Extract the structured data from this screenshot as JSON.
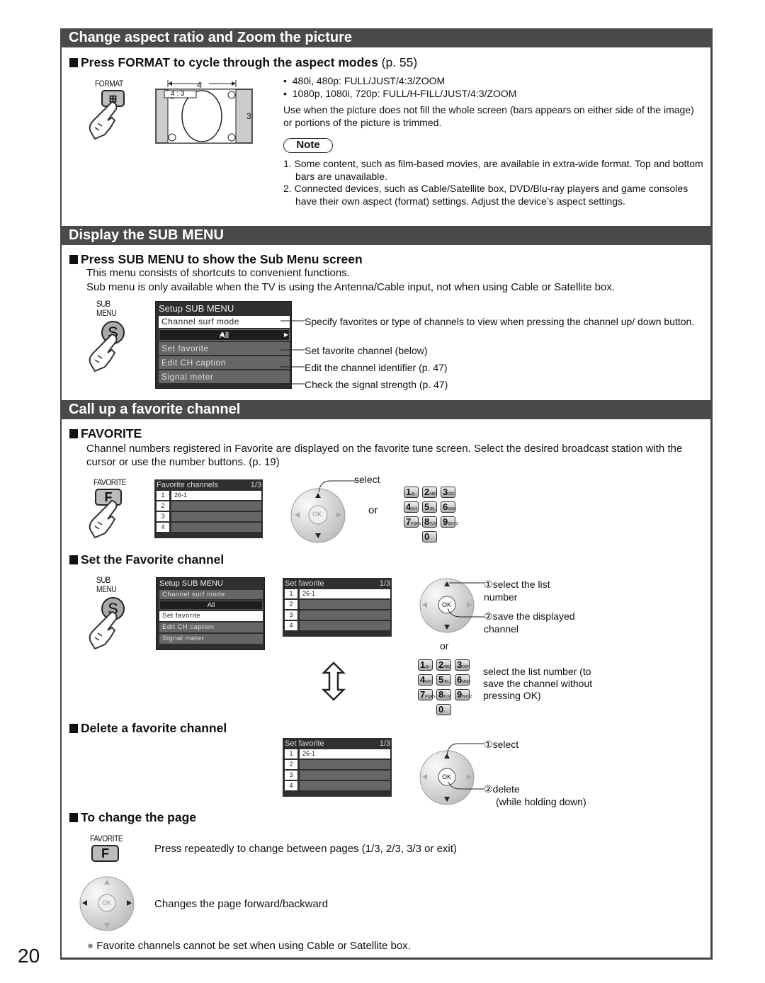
{
  "page_number": "20",
  "sections": {
    "aspect": {
      "title": "Change aspect ratio and Zoom the picture",
      "sub_title": "Press FORMAT to cycle through the aspect modes",
      "sub_title_ref": "(p. 55)",
      "button_label": "FORMAT",
      "diagram": {
        "width_label": "4",
        "height_label": "3",
        "ratio_label": "4 : 3"
      },
      "bullets": [
        "480i, 480p:  FULL/JUST/4:3/ZOOM",
        "1080p, 1080i, 720p:  FULL/H-FILL/JUST/4:3/ZOOM"
      ],
      "description": "Use when the picture does not fill the whole screen (bars appears on either side of the image) or portions of the picture is trimmed.",
      "note_label": "Note",
      "notes": [
        "1. Some content, such as film-based movies, are available in extra-wide format. Top and bottom bars are unavailable.",
        "2. Connected devices, such as Cable/Satellite box, DVD/Blu-ray players and game consoles have their own aspect (format) settings. Adjust the device’s aspect settings."
      ]
    },
    "submenu": {
      "title": "Display the SUB MENU",
      "sub_title": "Press SUB MENU to show the Sub Menu screen",
      "lines": [
        "This menu consists of shortcuts to convenient functions.",
        "Sub menu is only available when the TV is using the Antenna/Cable input, not when using Cable or Satellite box."
      ],
      "button_label_1": "SUB",
      "button_label_2": "MENU",
      "button_glyph": "S",
      "menu": {
        "title": "Setup SUB MENU",
        "items": [
          "Channel surf mode",
          "Set favorite",
          "Edit CH caption",
          "Signal meter"
        ],
        "value": "All"
      },
      "callouts": [
        "Specify favorites or type of channels to view when pressing the channel up/ down button.",
        "Set favorite channel (below)",
        "Edit the channel identifier (p. 47)",
        "Check the signal strength (p. 47)"
      ]
    },
    "favorite": {
      "title": "Call up a favorite channel",
      "sub_title": "FAVORITE",
      "description": "Channel numbers registered in Favorite are displayed on the favorite tune screen. Select the desired broadcast station with the cursor or use the number buttons. (p. 19)",
      "button_label": "FAVORITE",
      "button_glyph": "F",
      "list": {
        "title": "Favorite channels",
        "page": "1/3",
        "rows": [
          {
            "n": "1",
            "ch": "26-1"
          },
          {
            "n": "2",
            "ch": ""
          },
          {
            "n": "3",
            "ch": ""
          },
          {
            "n": "4",
            "ch": ""
          }
        ]
      },
      "select_label": "select",
      "or_label": "or",
      "ok_label": "OK",
      "keys": [
        {
          "d": "1",
          "s": "@.-"
        },
        {
          "d": "2",
          "s": "ABC"
        },
        {
          "d": "3",
          "s": "DEF"
        },
        {
          "d": "4",
          "s": "GHI"
        },
        {
          "d": "5",
          "s": "JKL"
        },
        {
          "d": "6",
          "s": "MNO"
        },
        {
          "d": "7",
          "s": "PQRS"
        },
        {
          "d": "8",
          "s": "TUV"
        },
        {
          "d": "9",
          "s": "WXYZ"
        },
        {
          "d": "0",
          "s": "-."
        }
      ],
      "set": {
        "sub_title": "Set the Favorite channel",
        "menu": {
          "title": "Setup SUB MENU",
          "items": [
            "Channel surf mode",
            "Set favorite",
            "Edit CH caption",
            "Signal meter"
          ],
          "value": "All"
        },
        "list": {
          "title": "Set favorite",
          "page": "1/3",
          "rows": [
            {
              "n": "1",
              "ch": "26-1"
            },
            {
              "n": "2",
              "ch": ""
            },
            {
              "n": "3",
              "ch": ""
            },
            {
              "n": "4",
              "ch": ""
            }
          ]
        },
        "step1": "select the list number",
        "step2": "save the displayed channel",
        "or_label": "or",
        "keypad_note": "select the list number (to save the channel without pressing OK)"
      },
      "delete": {
        "sub_title": "Delete a favorite channel",
        "list": {
          "title": "Set favorite",
          "page": "1/3",
          "rows": [
            {
              "n": "1",
              "ch": "26-1"
            },
            {
              "n": "2",
              "ch": ""
            },
            {
              "n": "3",
              "ch": ""
            },
            {
              "n": "4",
              "ch": ""
            }
          ]
        },
        "step1": "select",
        "step2": "delete",
        "step2_note": "(while holding down)"
      },
      "page": {
        "sub_title": "To change the page",
        "button_label": "FAVORITE",
        "button_glyph": "F",
        "line1": "Press repeatedly to change between pages (1/3, 2/3, 3/3 or exit)",
        "line2": "Changes the page forward/backward"
      },
      "footnote": "Favorite channels cannot be set when using Cable or Satellite box."
    }
  }
}
